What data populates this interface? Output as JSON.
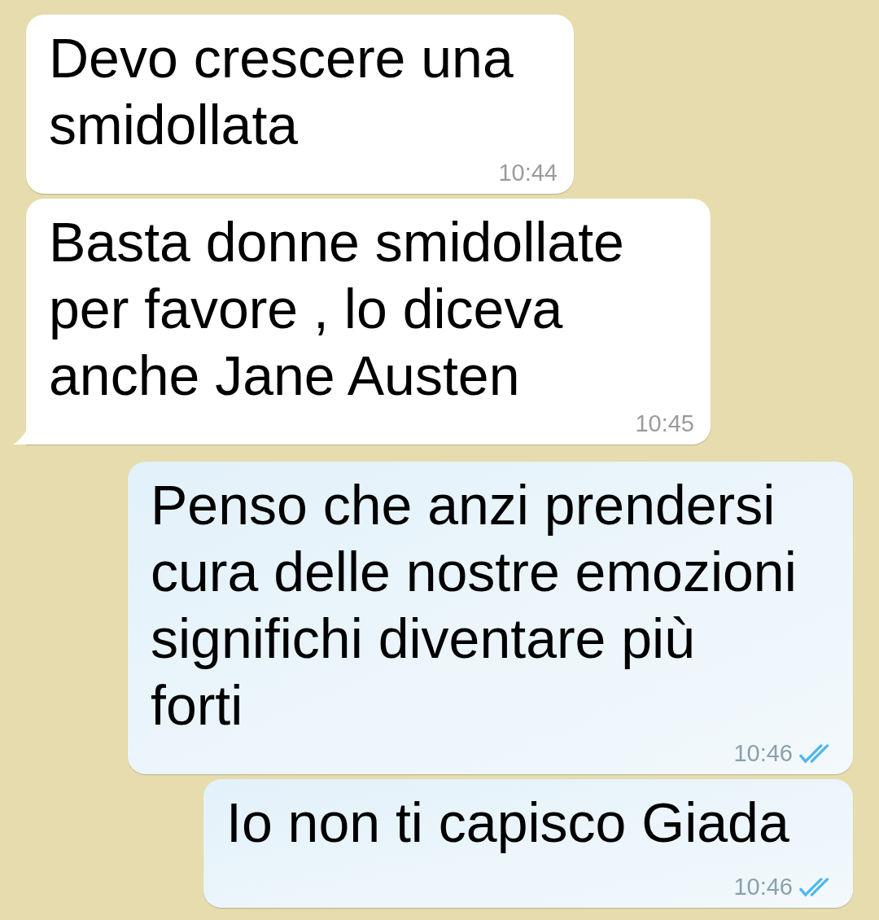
{
  "messages": [
    {
      "kind": "in",
      "text": "Devo crescere una smidollata",
      "time": "10:44",
      "tail": false
    },
    {
      "kind": "in",
      "text": "Basta donne smidollate per favore , lo diceva anche Jane Austen",
      "time": "10:45",
      "tail": true
    },
    {
      "kind": "out",
      "text": "Penso che anzi prendersi cura delle nostre emozioni significhi diventare più forti",
      "time": "10:46",
      "read": true
    },
    {
      "kind": "out",
      "text": "Io non ti capisco Giada",
      "time": "10:46",
      "read": true
    }
  ]
}
